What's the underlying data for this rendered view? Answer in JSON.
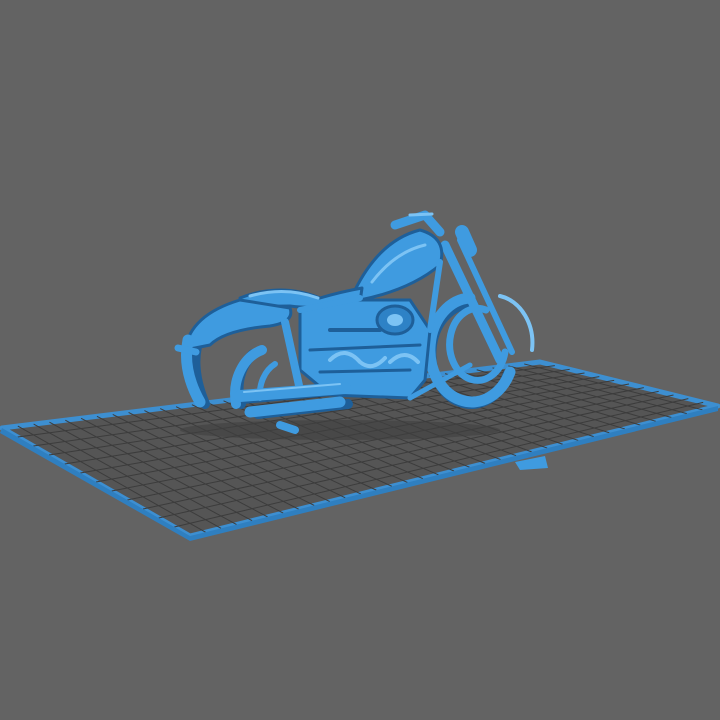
{
  "viewport": {
    "background_color": "#636363",
    "bed_fill_color": "#555555",
    "bed_edge_color": "#3d8fd1",
    "grid_line_color": "#3c3c3c",
    "model_color": "#3f9be0",
    "model_shade_color": "#1e5f99",
    "model_highlight_color": "#7cc3f4",
    "model_name": "motorcycle-model"
  }
}
